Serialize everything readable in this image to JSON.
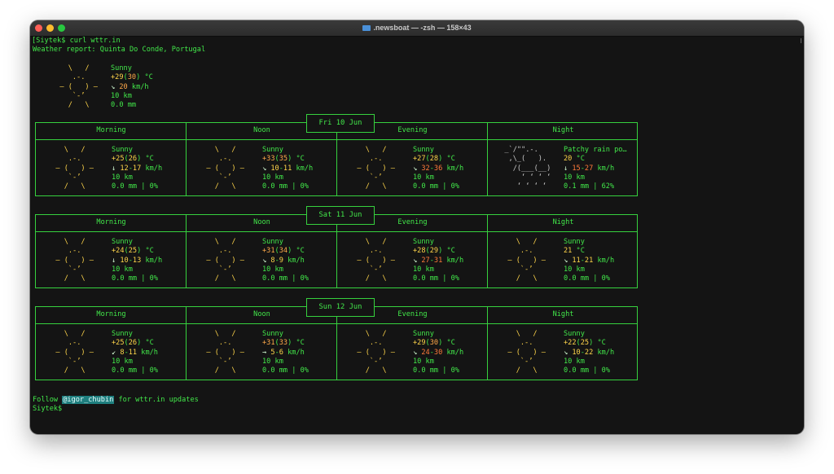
{
  "window": {
    "title": ".newsboat — -zsh — 158×43"
  },
  "prompt": {
    "command_line": "[Siytek$ curl wttr.in",
    "end_prompt": "Siytek$"
  },
  "report": {
    "header": "Weather report: Quinta Do Conde, Portugal",
    "current": {
      "condition": "Sunny",
      "temp": "+29",
      "feels": "30",
      "unit": " °C",
      "wind_arrow": "↘",
      "wind": "20",
      "wind_unit": " km/h",
      "visibility": "10 km",
      "precip": "0.0 mm"
    }
  },
  "phases": [
    "Morning",
    "Noon",
    "Evening",
    "Night"
  ],
  "days": [
    {
      "date": "Fri 10 Jun",
      "slots": [
        {
          "icon": "sun-icon",
          "condition": "Sunny",
          "t1": "+25",
          "t2": "26",
          "unit": " °C",
          "arrow": "↓",
          "w1": "12",
          "w2": "17",
          "vis": "10 km",
          "precip": "0.0 mm | 0%"
        },
        {
          "icon": "sun-icon",
          "condition": "Sunny",
          "t1": "+33",
          "t2": "35",
          "unit": " °C",
          "arrow": "↘",
          "w1": "10",
          "w2": "11",
          "vis": "10 km",
          "precip": "0.0 mm | 0%"
        },
        {
          "icon": "sun-icon",
          "condition": "Sunny",
          "t1": "+27",
          "t2": "28",
          "unit": " °C",
          "arrow": "↘",
          "w1": "32",
          "w2": "36",
          "vis": "10 km",
          "precip": "0.0 mm | 0%"
        },
        {
          "icon": "rain-cloud-icon",
          "condition": "Patchy rain po…",
          "t1": "20",
          "t2": "",
          "unit": " °C",
          "arrow": "↓",
          "w1": "15",
          "w2": "27",
          "vis": "10 km",
          "precip": "0.1 mm | 62%"
        }
      ]
    },
    {
      "date": "Sat 11 Jun",
      "slots": [
        {
          "icon": "sun-icon",
          "condition": "Sunny",
          "t1": "+24",
          "t2": "25",
          "unit": " °C",
          "arrow": "↓",
          "w1": "10",
          "w2": "13",
          "vis": "10 km",
          "precip": "0.0 mm | 0%"
        },
        {
          "icon": "sun-icon",
          "condition": "Sunny",
          "t1": "+31",
          "t2": "34",
          "unit": " °C",
          "arrow": "↘",
          "w1": "8",
          "w2": "9",
          "vis": "10 km",
          "precip": "0.0 mm | 0%"
        },
        {
          "icon": "sun-icon",
          "condition": "Sunny",
          "t1": "+28",
          "t2": "29",
          "unit": " °C",
          "arrow": "↘",
          "w1": "27",
          "w2": "31",
          "vis": "10 km",
          "precip": "0.0 mm | 0%"
        },
        {
          "icon": "sun-icon",
          "condition": "Sunny",
          "t1": "21",
          "t2": "",
          "unit": " °C",
          "arrow": "↘",
          "w1": "11",
          "w2": "21",
          "vis": "10 km",
          "precip": "0.0 mm | 0%"
        }
      ]
    },
    {
      "date": "Sun 12 Jun",
      "slots": [
        {
          "icon": "sun-icon",
          "condition": "Sunny",
          "t1": "+25",
          "t2": "26",
          "unit": " °C",
          "arrow": "↙",
          "w1": "8",
          "w2": "11",
          "vis": "10 km",
          "precip": "0.0 mm | 0%"
        },
        {
          "icon": "sun-icon",
          "condition": "Sunny",
          "t1": "+31",
          "t2": "33",
          "unit": " °C",
          "arrow": "→",
          "w1": "5",
          "w2": "6",
          "vis": "10 km",
          "precip": "0.0 mm | 0%"
        },
        {
          "icon": "sun-icon",
          "condition": "Sunny",
          "t1": "+29",
          "t2": "30",
          "unit": " °C",
          "arrow": "↘",
          "w1": "24",
          "w2": "30",
          "vis": "10 km",
          "precip": "0.0 mm | 0%"
        },
        {
          "icon": "sun-icon",
          "condition": "Sunny",
          "t1": "+22",
          "t2": "25",
          "unit": " °C",
          "arrow": "↘",
          "w1": "10",
          "w2": "22",
          "vis": "10 km",
          "precip": "0.0 mm | 0%"
        }
      ]
    }
  ],
  "footer": {
    "prefix": "Follow ",
    "handle": "@igor_chubin",
    "suffix": " for wttr.in updates"
  },
  "colors": {
    "terminal_bg": "#141414",
    "text_green": "#42e84a",
    "temp_yellow": "#ffd54a",
    "temp_orange": "#ffa94a",
    "wind_red": "#ff7a3a",
    "link_bg": "#1f7f7f"
  }
}
